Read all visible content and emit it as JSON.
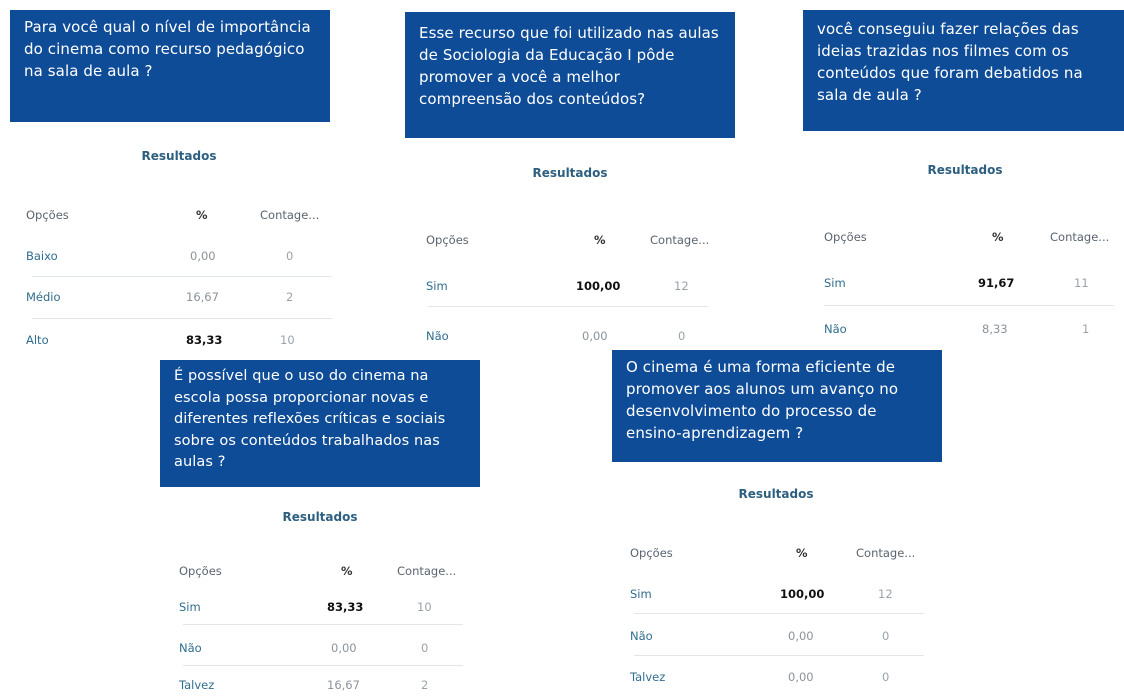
{
  "results_title": "Resultados",
  "headers": {
    "options": "Opções",
    "percent": "%",
    "count": "Contage..."
  },
  "panels": [
    {
      "question": "Para você qual o nível de importância do cinema como recurso pedagógico na sala de aula ?",
      "rows": [
        {
          "option": "Baixo",
          "percent": "0,00",
          "count": "0",
          "bold": false
        },
        {
          "option": "Médio",
          "percent": "16,67",
          "count": "2",
          "bold": false
        },
        {
          "option": "Alto",
          "percent": "83,33",
          "count": "10",
          "bold": true
        }
      ]
    },
    {
      "question": "Esse recurso que foi utilizado nas aulas de Sociologia da Educação I pôde promover a você a melhor compreensão dos conteúdos?",
      "rows": [
        {
          "option": "Sim",
          "percent": "100,00",
          "count": "12",
          "bold": true
        },
        {
          "option": "Não",
          "percent": "0,00",
          "count": "0",
          "bold": false
        }
      ]
    },
    {
      "question": "você conseguiu fazer relações das ideias trazidas nos filmes com os conteúdos que foram debatidos na sala de aula ?",
      "rows": [
        {
          "option": "Sim",
          "percent": "91,67",
          "count": "11",
          "bold": true
        },
        {
          "option": "Não",
          "percent": "8,33",
          "count": "1",
          "bold": false
        }
      ]
    },
    {
      "question": "É possível que o uso do cinema na escola possa proporcionar novas e diferentes reflexões críticas e sociais sobre os conteúdos trabalhados nas aulas ?",
      "rows": [
        {
          "option": "Sim",
          "percent": "83,33",
          "count": "10",
          "bold": true
        },
        {
          "option": "Não",
          "percent": "0,00",
          "count": "0",
          "bold": false
        },
        {
          "option": "Talvez",
          "percent": "16,67",
          "count": "2",
          "bold": false
        }
      ]
    },
    {
      "question": "O cinema é uma forma eficiente de promover aos alunos um avanço no desenvolvimento do processo de ensino-aprendizagem ?",
      "rows": [
        {
          "option": "Sim",
          "percent": "100,00",
          "count": "12",
          "bold": true
        },
        {
          "option": "Não",
          "percent": "0,00",
          "count": "0",
          "bold": false
        },
        {
          "option": "Talvez",
          "percent": "0,00",
          "count": "0",
          "bold": false
        }
      ]
    }
  ]
}
